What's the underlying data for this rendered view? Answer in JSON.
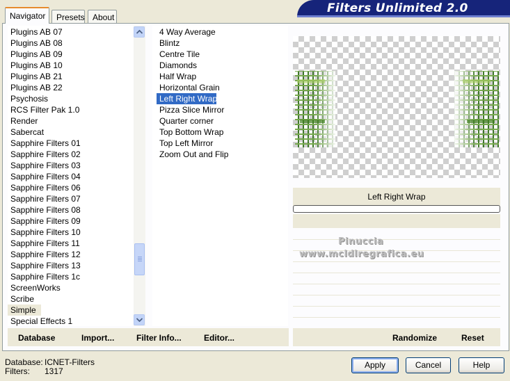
{
  "tabs": [
    {
      "label": "Navigator",
      "active": true
    },
    {
      "label": "Presets",
      "active": false
    },
    {
      "label": "About",
      "active": false
    }
  ],
  "title": "Filters Unlimited 2.0",
  "categories": [
    "Plugins AB 07",
    "Plugins AB 08",
    "Plugins AB 09",
    "Plugins AB 10",
    "Plugins AB 21",
    "Plugins AB 22",
    "Psychosis",
    "RCS Filter Pak 1.0",
    "Render",
    "Sabercat",
    "Sapphire Filters 01",
    "Sapphire Filters 02",
    "Sapphire Filters 03",
    "Sapphire Filters 04",
    "Sapphire Filters 06",
    "Sapphire Filters 07",
    "Sapphire Filters 08",
    "Sapphire Filters 09",
    "Sapphire Filters 10",
    "Sapphire Filters 11",
    "Sapphire Filters 12",
    "Sapphire Filters 13",
    "Sapphire Filters 1c",
    "ScreenWorks",
    "Scribe",
    "Simple",
    "Special Effects 1"
  ],
  "selected_category": "Simple",
  "filters": [
    "4 Way Average",
    "Blintz",
    "Centre Tile",
    "Diamonds",
    "Half Wrap",
    "Horizontal Grain",
    "Left Right Wrap",
    "Pizza Slice Mirror",
    "Quarter corner",
    "Top Bottom Wrap",
    "Top Left Mirror",
    "Zoom Out and Flip"
  ],
  "selected_filter": "Left Right Wrap",
  "preview_filter_name": "Left Right Wrap",
  "watermark": {
    "line1": "Pinuccia",
    "line2": "www.mcldlregrafica.eu"
  },
  "toolbar_left": {
    "database": "Database",
    "import": "Import...",
    "filter_info": "Filter Info...",
    "editor": "Editor..."
  },
  "toolbar_right": {
    "randomize": "Randomize",
    "reset": "Reset"
  },
  "status": {
    "database_label": "Database:",
    "database_value": "ICNET-Filters",
    "filters_label": "Filters:",
    "filters_value": "1317"
  },
  "buttons": {
    "apply": "Apply",
    "cancel": "Cancel",
    "help": "Help"
  },
  "colors": {
    "selection_blue": "#316ac5",
    "banner": "#16247a",
    "tab_highlight": "#e68b2c"
  }
}
